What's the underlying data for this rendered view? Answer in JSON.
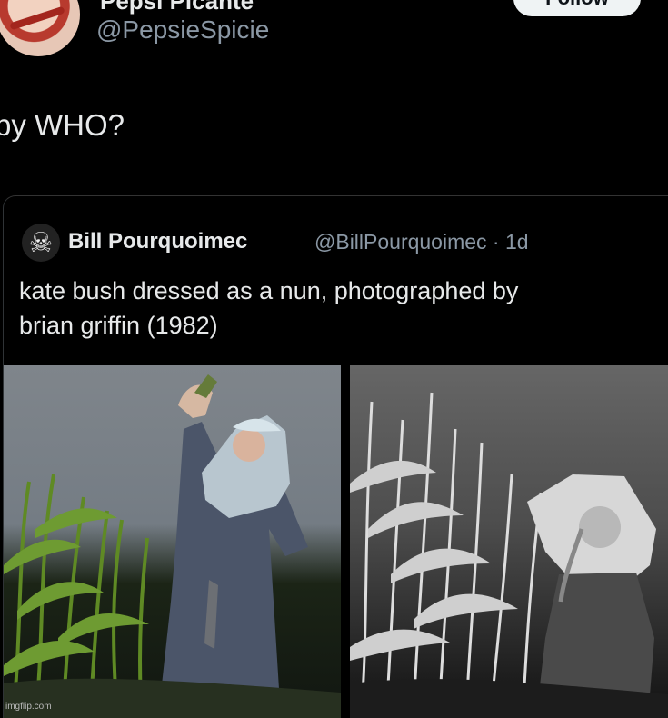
{
  "post": {
    "display_name": "Pepsi Picante",
    "handle": "@PepsieSpicie",
    "follow_label": "Follow",
    "text": "by WHO?"
  },
  "quoted_post": {
    "avatar_icon": "skull-icon",
    "name": "Bill Pourquoimec",
    "handle": "@BillPourquoimec · 1d",
    "text_lines": [
      "kate bush dressed as a nun, photographed by",
      "brian griffin (1982)"
    ]
  },
  "watermark": "imgflip.com",
  "colors": {
    "background": "#000000",
    "text": "#e7e9ea",
    "secondary_text": "#8b98a5"
  }
}
